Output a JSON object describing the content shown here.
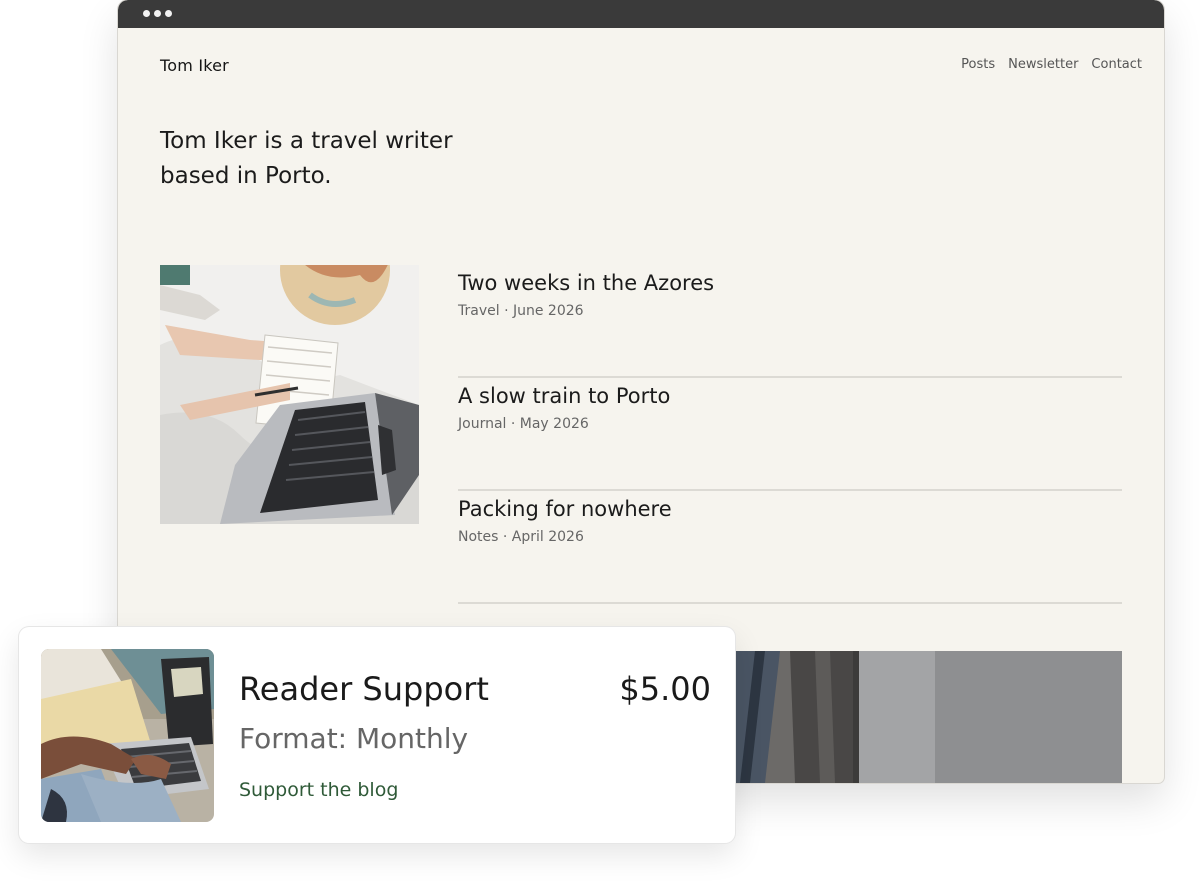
{
  "site": {
    "title": "Tom Iker",
    "nav": [
      "Posts",
      "Newsletter",
      "Contact"
    ],
    "intro": "Tom Iker is a travel writer based in Porto."
  },
  "posts": [
    {
      "title": "Two weeks in the Azores",
      "meta": "Travel · June 2026"
    },
    {
      "title": "A slow train to Porto",
      "meta": "Journal · May 2026"
    },
    {
      "title": "Packing for nowhere",
      "meta": "Notes · April 2026"
    }
  ],
  "card": {
    "title": "Reader Support",
    "price": "$5.00",
    "format": "Format: Monthly",
    "link": "Support the blog"
  },
  "colors": {
    "page_bg": "#f6f4ee",
    "titlebar": "#3a3a3a",
    "link_green": "#2f5a38"
  },
  "icons": {
    "window_controls": "three-dots-icon"
  }
}
